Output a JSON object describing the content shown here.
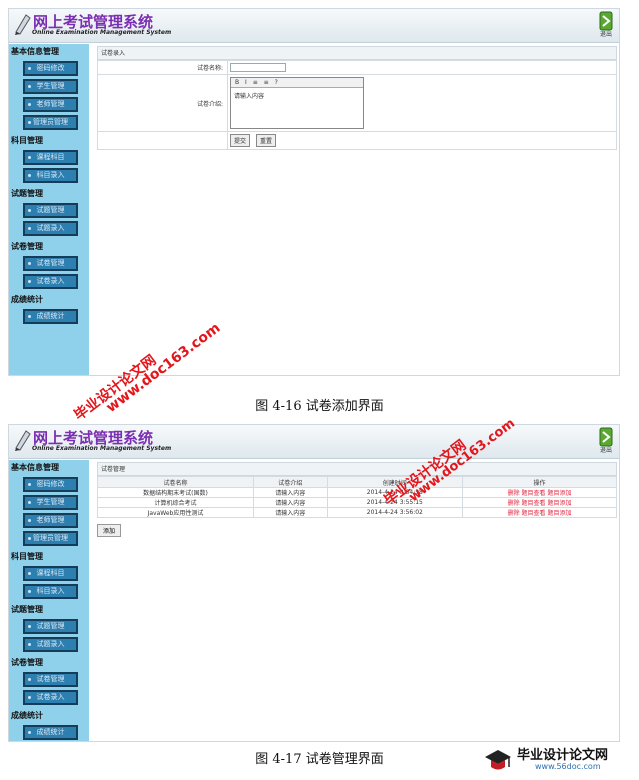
{
  "app": {
    "title_cn": "网上考试管理系统",
    "title_en": "Online Examination Management System",
    "exit_label": "退出"
  },
  "sidebar": {
    "groups": [
      {
        "label": "基本信息管理",
        "items": [
          "密码修改",
          "学生管理",
          "老师管理",
          "管理员管理"
        ]
      },
      {
        "label": "科目管理",
        "items": [
          "课程科目",
          "科目录入"
        ]
      },
      {
        "label": "试题管理",
        "items": [
          "试题管理",
          "试题录入"
        ]
      },
      {
        "label": "试卷管理",
        "items": [
          "试卷管理",
          "试卷录入"
        ]
      },
      {
        "label": "成绩统计",
        "items": [
          "成绩统计"
        ]
      }
    ]
  },
  "screen1": {
    "panel_title": "试卷录入",
    "name_label": "试卷名称:",
    "name_value": "",
    "intro_label": "试卷介绍:",
    "editor_toolbar": "B I ≡ ≡ ?",
    "editor_content": "请输入内容",
    "submit_label": "提交",
    "reset_label": "重置",
    "caption": "图 4-16  试卷添加界面"
  },
  "screen2": {
    "panel_title": "试卷管理",
    "columns": [
      "试卷名称",
      "试卷介绍",
      "创建时间",
      "操作"
    ],
    "rows": [
      {
        "name": "数据结构期末考试(国数)",
        "intro": "请输入内容",
        "time": "2014-4-24 3:54:58",
        "ops": "删除 题目查看 题目添加"
      },
      {
        "name": "计算机综合考试",
        "intro": "请输入内容",
        "time": "2014-4-24 3:55:15",
        "ops": "删除 题目查看 题目添加"
      },
      {
        "name": "JavaWeb应用性测试",
        "intro": "请输入内容",
        "time": "2014-4-24 3:56:02",
        "ops": "删除 题目查看 题目添加"
      }
    ],
    "add_label": "添加",
    "caption": "图 4-17  试卷管理界面"
  },
  "watermarks": {
    "cn": "毕业设计论文网",
    "url": "www.doc163.com"
  },
  "footer_logo": {
    "cn": "毕业设计论文网",
    "url": "www.56doc.com"
  },
  "colors": {
    "sidebar_bg": "#8fd0ea",
    "nav_button": "#2d7fb0",
    "title_purple": "#7a2fb0",
    "watermark_red": "#e3161c",
    "op_link_red": "#e0203a"
  }
}
